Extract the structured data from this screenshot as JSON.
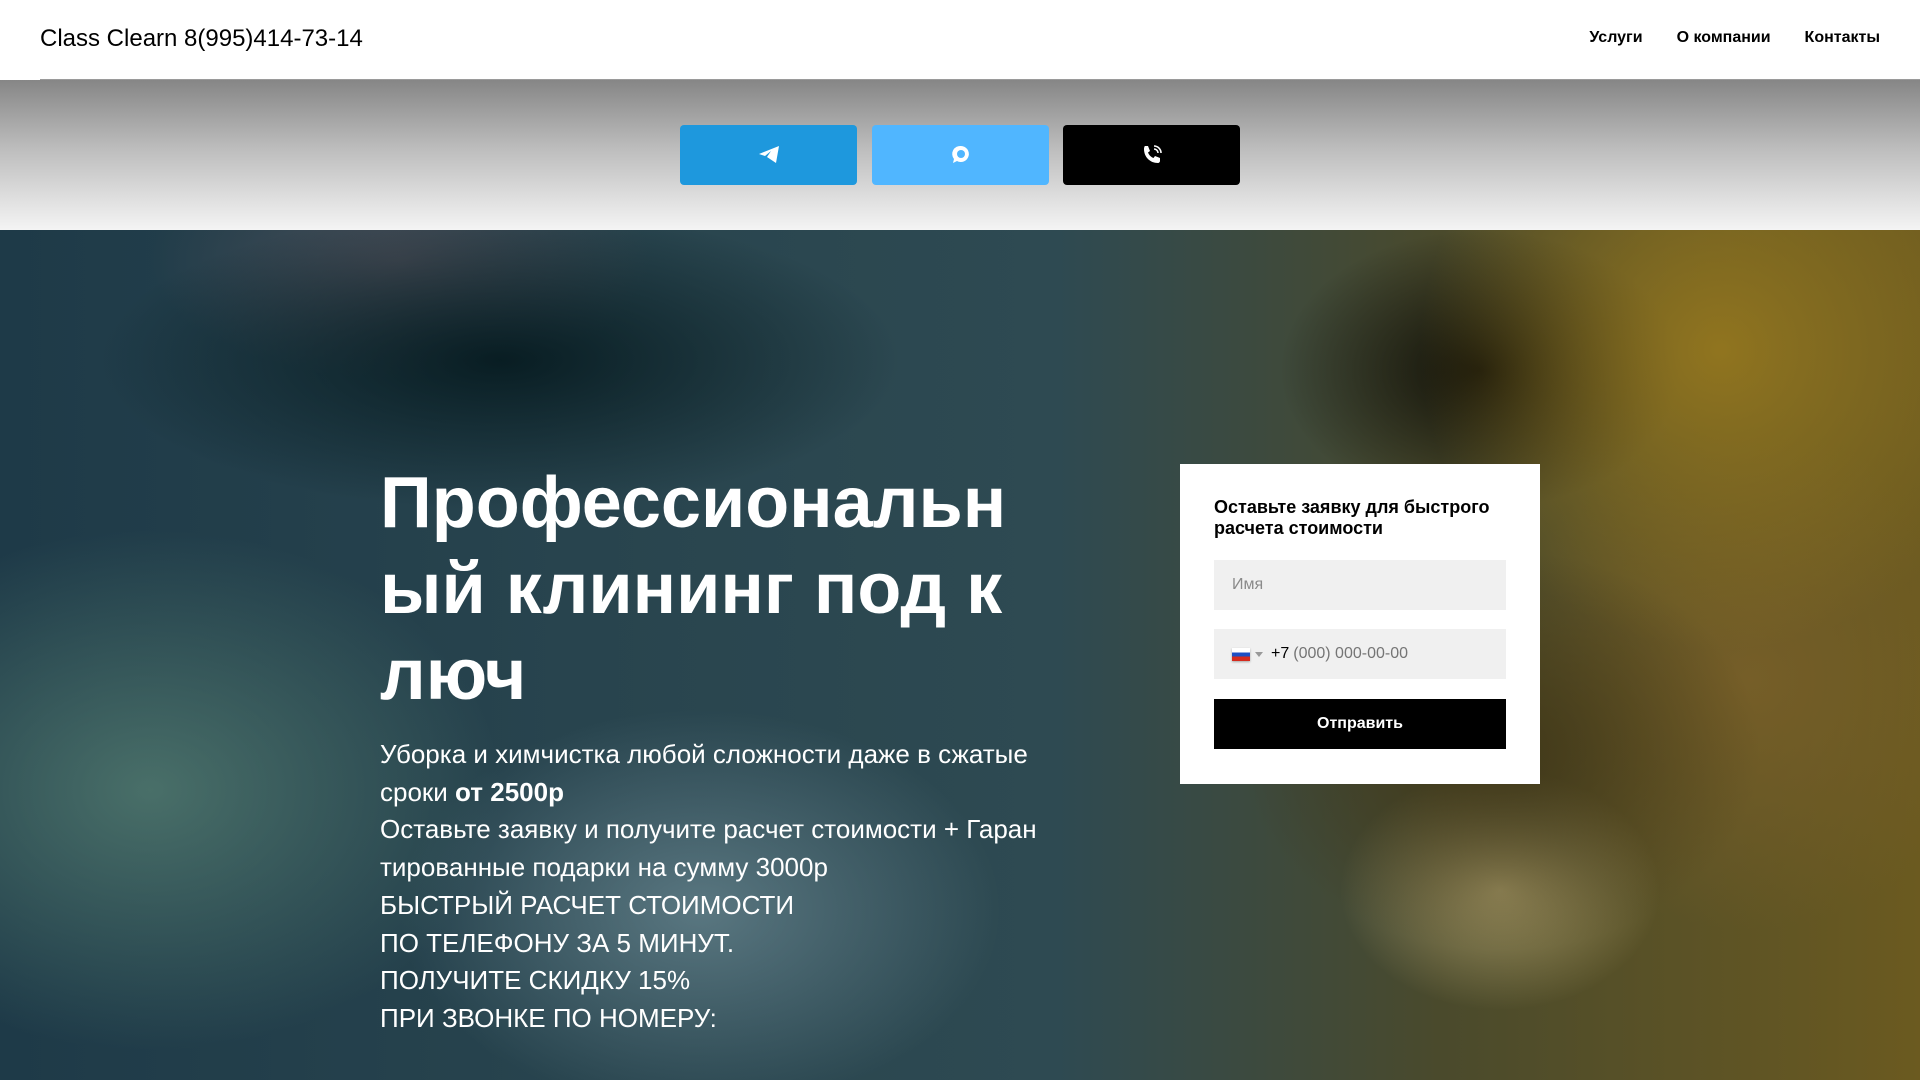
{
  "header": {
    "logo": "Class Clearn 8(995)414-73-14",
    "nav": [
      "Услуги",
      "О компании",
      "Контакты"
    ]
  },
  "contact_buttons": [
    {
      "icon": "telegram-icon",
      "color": "#1e98dd"
    },
    {
      "icon": "chat-icon",
      "color": "#50b6ff"
    },
    {
      "icon": "viber-icon",
      "color": "#000000"
    }
  ],
  "hero": {
    "title_lines": [
      "Профессиональн",
      "ый клининг под к",
      "люч"
    ],
    "sub1": "Уборка и химчистка любой сложности даже в сжатые сроки ",
    "sub1_bold": "от 2500р",
    "sub2": "Оставьте заявку и получите расчет стоимости + Гаран тированные подарки на сумму 3000р",
    "lines": [
      "БЫСТРЫЙ РАСЧЕТ СТОИМОСТИ",
      "ПО ТЕЛЕФОНУ ЗА 5 МИНУТ.",
      "ПОЛУЧИТЕ СКИДКУ 15%",
      "ПРИ ЗВОНКЕ ПО НОМЕРУ:"
    ]
  },
  "form": {
    "heading": "Оставьте заявку для быстрого расчета стоимости",
    "name_placeholder": "Имя",
    "phone_code": "+7",
    "phone_placeholder": "(000) 000-00-00",
    "submit": "Отправить"
  }
}
